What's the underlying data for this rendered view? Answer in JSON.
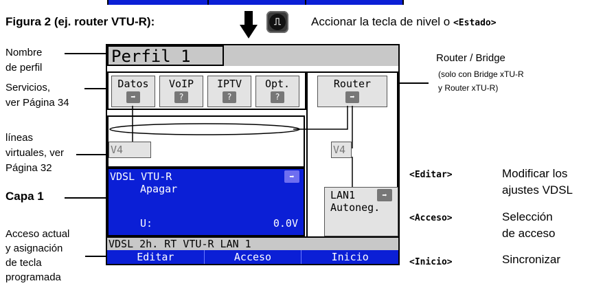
{
  "header": {
    "figure_title": "Figura 2 (ej. router VTU-R):",
    "knob_symbol": "⎍",
    "instruction_text": "Accionar la tecla de nivel o",
    "instruction_key": "<Estado>"
  },
  "left_labels": {
    "profile_name_1": "Nombre",
    "profile_name_2": "de perfil",
    "services_1": "Servicios,",
    "services_2": "ver Página 34",
    "vlines_1": "líneas",
    "vlines_2": "virtuales, ver",
    "vlines_3": "Página 32",
    "layer1": "Capa 1",
    "access_1": "Acceso actual",
    "access_2": "y asignación",
    "access_3": "de tecla",
    "access_4": "programada"
  },
  "right_labels": {
    "router_bridge": "Router / Bridge",
    "router_note_1": "(solo con Bridge xTU-R",
    "router_note_2": "y Router xTU-R)",
    "key_edit": "<Editar>",
    "desc_edit_1": "Modificar los",
    "desc_edit_2": "ajustes VDSL",
    "key_access": "<Acceso>",
    "desc_access_1": "Selección",
    "desc_access_2": "de acceso",
    "key_home": "<Inicio>",
    "desc_home": "Sincronizar"
  },
  "screen": {
    "profile_name": "Perfil 1",
    "services": [
      {
        "label": "Datos",
        "icon": "arrow-right-icon",
        "glyph": "➡"
      },
      {
        "label": "VoIP",
        "icon": "question-icon",
        "glyph": "?"
      },
      {
        "label": "IPTV",
        "icon": "question-icon",
        "glyph": "?"
      },
      {
        "label": "Opt.",
        "icon": "question-icon",
        "glyph": "?"
      }
    ],
    "router_label": "Router",
    "router_glyph": "➡",
    "v4_left": "V4",
    "v4_right": "V4",
    "vdsl_title": "VDSL VTU-R",
    "vdsl_state": "Apagar",
    "vdsl_u_label": "U:",
    "vdsl_u_value": "0.0V",
    "vdsl_glyph": "➡",
    "lan_label": "LAN1",
    "lan_glyph": "➡",
    "lan_mode": "Autoneg.",
    "status_text": "VDSL 2h. RT VTU-R LAN 1",
    "softkeys": [
      "Editar",
      "Acceso",
      "Inicio"
    ]
  },
  "colors": {
    "screen_blue": "#0b1fd6",
    "screen_grey": "#c8c8c8"
  }
}
